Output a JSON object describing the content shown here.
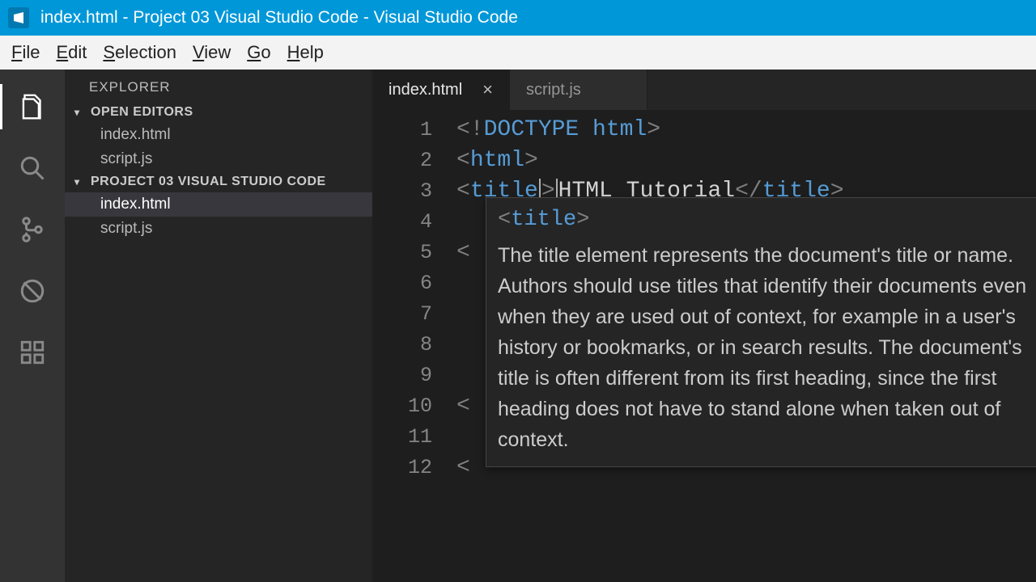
{
  "window": {
    "title": "index.html - Project 03 Visual Studio Code - Visual Studio Code"
  },
  "menubar": [
    "File",
    "Edit",
    "Selection",
    "View",
    "Go",
    "Help"
  ],
  "sidebar": {
    "title": "EXPLORER",
    "open_editors_label": "OPEN EDITORS",
    "open_editors": [
      "index.html",
      "script.js"
    ],
    "project_label": "PROJECT 03 VISUAL STUDIO CODE",
    "project_files": [
      "index.html",
      "script.js"
    ],
    "selected_file": "index.html"
  },
  "tabs": [
    {
      "label": "index.html",
      "active": true
    },
    {
      "label": "script.js",
      "active": false
    }
  ],
  "code": {
    "lines": [
      {
        "n": 1,
        "parts": [
          {
            "c": "pun",
            "t": "<!"
          },
          {
            "c": "doctype",
            "t": "DOCTYPE html"
          },
          {
            "c": "pun",
            "t": ">"
          }
        ]
      },
      {
        "n": 2,
        "parts": [
          {
            "c": "pun",
            "t": "<"
          },
          {
            "c": "tag",
            "t": "html"
          },
          {
            "c": "pun",
            "t": ">"
          }
        ]
      },
      {
        "n": 3,
        "parts": [
          {
            "c": "pun",
            "t": "<"
          },
          {
            "c": "tag",
            "t": "title"
          },
          {
            "c": "pun",
            "t": ">"
          },
          {
            "c": "text",
            "t": "HTML Tutorial"
          },
          {
            "c": "pun",
            "t": "</"
          },
          {
            "c": "tag",
            "t": "title"
          },
          {
            "c": "pun",
            "t": ">"
          }
        ]
      },
      {
        "n": 4,
        "parts": []
      },
      {
        "n": 5,
        "parts": [
          {
            "c": "pun",
            "t": "<"
          }
        ]
      },
      {
        "n": 6,
        "parts": []
      },
      {
        "n": 7,
        "parts": []
      },
      {
        "n": 8,
        "parts": []
      },
      {
        "n": 9,
        "parts": []
      },
      {
        "n": 10,
        "parts": [
          {
            "c": "pun",
            "t": "<"
          }
        ]
      },
      {
        "n": 11,
        "parts": []
      },
      {
        "n": 12,
        "parts": [
          {
            "c": "pun",
            "t": "<"
          }
        ]
      }
    ],
    "caret_line": 3,
    "caret_after_char": 7
  },
  "hover": {
    "signature_open": "<",
    "signature_tag": "title",
    "signature_close": ">",
    "body": "The title element represents the document's title or name. Authors should use titles that identify their documents even when they are used out of context, for example in a user's history or bookmarks, or in search results. The document's title is often different from its first heading, since the first heading does not have to stand alone when taken out of context."
  }
}
